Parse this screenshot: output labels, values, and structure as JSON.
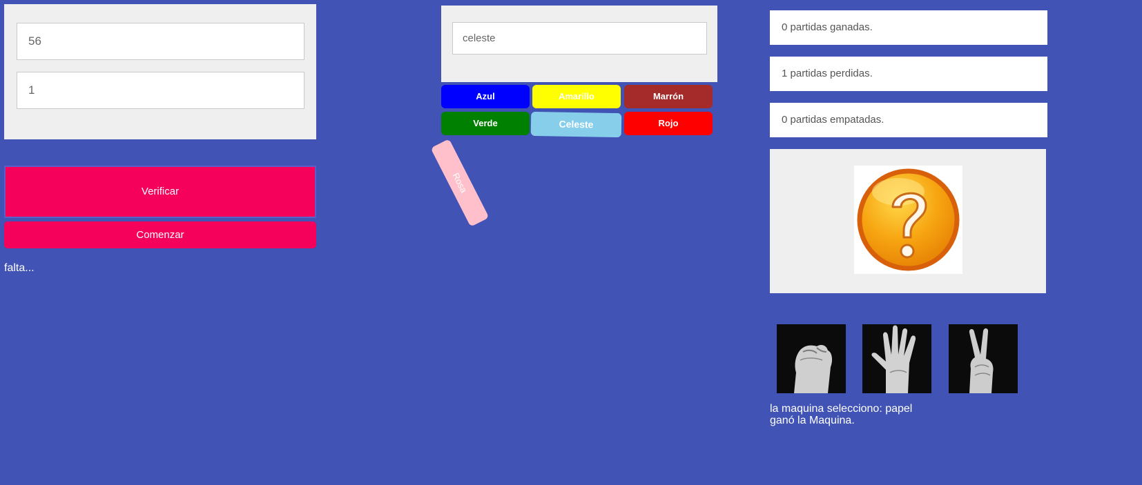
{
  "left": {
    "input_one_value": "56",
    "input_two_value": "1",
    "verify_label": "Verificar",
    "start_label": "Comenzar",
    "status": "falta..."
  },
  "colors": {
    "input_value": "celeste",
    "buttons": [
      {
        "label": "Azul",
        "color": "#0000ff"
      },
      {
        "label": "Amarillo",
        "color": "#ffff00"
      },
      {
        "label": "Marrón",
        "color": "#a52a2a"
      },
      {
        "label": "Verde",
        "color": "#008000"
      },
      {
        "label": "Celeste",
        "color": "#87ceeb"
      },
      {
        "label": "Rojo",
        "color": "#ff0000"
      },
      {
        "label": "Rosa",
        "color": "#ffc0cb"
      }
    ]
  },
  "game": {
    "won": "0 partidas ganadas.",
    "lost": "1 partidas perdidas.",
    "tied": "0 partidas empatadas.",
    "machine_choice": "la maquina selecciono: papel",
    "winner": "ganó la Maquina.",
    "hands": [
      {
        "icon": "rock-hand-icon"
      },
      {
        "icon": "paper-hand-icon"
      },
      {
        "icon": "scissors-hand-icon"
      }
    ],
    "question_icon": "question-mark-icon"
  }
}
